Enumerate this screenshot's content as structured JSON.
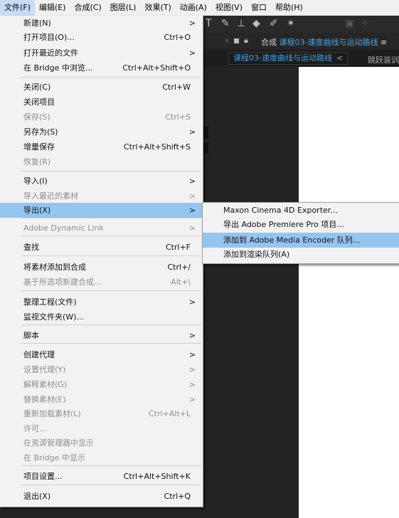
{
  "menubar": {
    "items": [
      "文件(F)",
      "编辑(E)",
      "合成(C)",
      "图层(L)",
      "效果(T)",
      "动画(A)",
      "视图(V)",
      "窗口",
      "帮助(H)"
    ]
  },
  "composition": {
    "prefix": "合成",
    "name": "课程03-速度曲线与运动路线",
    "menu_glyph": "≡",
    "tab_label": "课程03-速度曲线与运动路线",
    "tab_arrow": "<",
    "next_tab": "跳跃装训"
  },
  "file_menu": {
    "items": [
      {
        "label": "新建(N)",
        "shortcut": "",
        "submenu": true,
        "disabled": false
      },
      {
        "label": "打开项目(O)...",
        "shortcut": "Ctrl+O",
        "submenu": false,
        "disabled": false
      },
      {
        "label": "打开最近的文件",
        "shortcut": "",
        "submenu": true,
        "disabled": false
      },
      {
        "label": "在 Bridge 中浏览...",
        "shortcut": "Ctrl+Alt+Shift+O",
        "submenu": false,
        "disabled": false
      },
      {
        "label": "关闭(C)",
        "shortcut": "Ctrl+W",
        "submenu": false,
        "disabled": false
      },
      {
        "label": "关闭项目",
        "shortcut": "",
        "submenu": false,
        "disabled": false
      },
      {
        "label": "保存(S)",
        "shortcut": "Ctrl+S",
        "submenu": false,
        "disabled": true
      },
      {
        "label": "另存为(S)",
        "shortcut": "",
        "submenu": true,
        "disabled": false
      },
      {
        "label": "增量保存",
        "shortcut": "Ctrl+Alt+Shift+S",
        "submenu": false,
        "disabled": false
      },
      {
        "label": "恢复(R)",
        "shortcut": "",
        "submenu": false,
        "disabled": true
      },
      {
        "label": "导入(I)",
        "shortcut": "",
        "submenu": true,
        "disabled": false
      },
      {
        "label": "导入最近的素材",
        "shortcut": "",
        "submenu": true,
        "disabled": true
      },
      {
        "label": "导出(X)",
        "shortcut": "",
        "submenu": true,
        "disabled": false,
        "highlighted": true
      },
      {
        "label": "Adobe Dynamic Link",
        "shortcut": "",
        "submenu": true,
        "disabled": true
      },
      {
        "label": "查找",
        "shortcut": "Ctrl+F",
        "submenu": false,
        "disabled": false
      },
      {
        "label": "将素材添加到合成",
        "shortcut": "Ctrl+/",
        "submenu": false,
        "disabled": false
      },
      {
        "label": "基于所选项新建合成...",
        "shortcut": "Alt+\\",
        "submenu": false,
        "disabled": true
      },
      {
        "label": "整理工程(文件)",
        "shortcut": "",
        "submenu": true,
        "disabled": false
      },
      {
        "label": "监视文件夹(W)...",
        "shortcut": "",
        "submenu": false,
        "disabled": false
      },
      {
        "label": "脚本",
        "shortcut": "",
        "submenu": true,
        "disabled": false
      },
      {
        "label": "创建代理",
        "shortcut": "",
        "submenu": true,
        "disabled": false
      },
      {
        "label": "设置代理(Y)",
        "shortcut": "",
        "submenu": true,
        "disabled": true
      },
      {
        "label": "解释素材(G)",
        "shortcut": "",
        "submenu": true,
        "disabled": true
      },
      {
        "label": "替换素材(E)",
        "shortcut": "",
        "submenu": true,
        "disabled": true
      },
      {
        "label": "重新加载素材(L)",
        "shortcut": "Ctrl+Alt+L",
        "submenu": false,
        "disabled": true
      },
      {
        "label": "许可...",
        "shortcut": "",
        "submenu": false,
        "disabled": true
      },
      {
        "label": "在资源管理器中显示",
        "shortcut": "",
        "submenu": false,
        "disabled": true
      },
      {
        "label": "在 Bridge 中显示",
        "shortcut": "",
        "submenu": false,
        "disabled": true
      },
      {
        "label": "项目设置...",
        "shortcut": "Ctrl+Alt+Shift+K",
        "submenu": false,
        "disabled": false
      },
      {
        "label": "退出(X)",
        "shortcut": "Ctrl+Q",
        "submenu": false,
        "disabled": false
      }
    ],
    "submenu_arrow": ">"
  },
  "export_submenu": {
    "items": [
      {
        "label": "Maxon Cinema 4D Exporter...",
        "highlighted": false
      },
      {
        "label": "导出 Adobe Premiere Pro 项目...",
        "highlighted": false
      },
      {
        "label": "添加到 Adobe Media Encoder 队列...",
        "highlighted": true
      },
      {
        "label": "添加到渲染队列(A)",
        "highlighted": false
      }
    ]
  },
  "colors": {
    "menu_bg": "#f2f2f2",
    "highlight": "#93c5f0",
    "disabled_text": "#8d8d8d",
    "comp_name": "#4aa3df",
    "app_bg": "#232323"
  }
}
